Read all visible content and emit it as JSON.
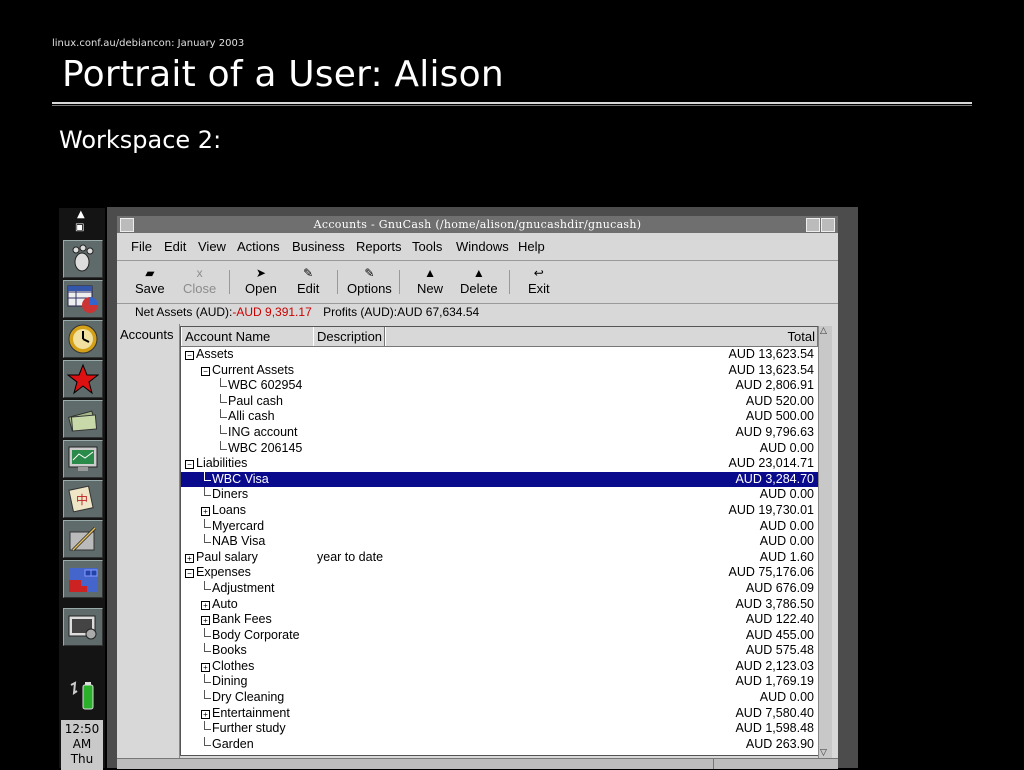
{
  "slide": {
    "source": "linux.conf.au/debiancon: January 2003",
    "title": "Portrait of a User: Alison",
    "subtitle": "Workspace 2:"
  },
  "dock": {
    "items": [
      "gnome-foot-icon",
      "spreadsheet-chart-icon",
      "mail-clock-icon",
      "star-icon",
      "money-icon",
      "monitor-icon",
      "game-tile-icon",
      "drawing-icon",
      "tetris-icon",
      "terminal-icon"
    ],
    "clock": {
      "time": "12:50",
      "ampm": "AM",
      "day": "Thu"
    }
  },
  "window": {
    "title": "Accounts - GnuCash (/home/alison/gnucashdir/gnucash)",
    "menus": [
      "File",
      "Edit",
      "View",
      "Actions",
      "Business",
      "Reports",
      "Tools",
      "Windows",
      "Help"
    ],
    "toolbar": [
      {
        "label": "Save",
        "icon": "save-icon",
        "enabled": true
      },
      {
        "label": "Close",
        "icon": "close-icon",
        "enabled": false
      },
      {
        "label": "Open",
        "icon": "open-icon",
        "enabled": true
      },
      {
        "label": "Edit",
        "icon": "edit-icon",
        "enabled": true
      },
      {
        "label": "Options",
        "icon": "options-icon",
        "enabled": true
      },
      {
        "label": "New",
        "icon": "new-icon",
        "enabled": true
      },
      {
        "label": "Delete",
        "icon": "delete-icon",
        "enabled": true
      },
      {
        "label": "Exit",
        "icon": "exit-icon",
        "enabled": true
      }
    ],
    "summary": {
      "net_assets_label": "Net Assets (AUD):",
      "net_assets_value": "-AUD 9,391.17",
      "profits_label": "Profits (AUD):",
      "profits_value": "AUD 67,634.54"
    },
    "accounts_tab": "Accounts",
    "columns": {
      "name": "Account Name",
      "description": "Description",
      "total": "Total"
    },
    "rows": [
      {
        "name": "Assets",
        "level": 0,
        "expander": "minus",
        "desc": "",
        "total": "AUD 13,623.54"
      },
      {
        "name": "Current Assets",
        "level": 1,
        "expander": "minus",
        "desc": "",
        "total": "AUD 13,623.54"
      },
      {
        "name": "WBC 602954",
        "level": 2,
        "expander": "",
        "desc": "",
        "total": "AUD 2,806.91"
      },
      {
        "name": "Paul cash",
        "level": 2,
        "expander": "",
        "desc": "",
        "total": "AUD 520.00"
      },
      {
        "name": "Alli cash",
        "level": 2,
        "expander": "",
        "desc": "",
        "total": "AUD 500.00"
      },
      {
        "name": "ING account",
        "level": 2,
        "expander": "",
        "desc": "",
        "total": "AUD 9,796.63"
      },
      {
        "name": "WBC 206145",
        "level": 2,
        "expander": "",
        "desc": "",
        "total": "AUD 0.00"
      },
      {
        "name": "Liabilities",
        "level": 0,
        "expander": "minus",
        "desc": "",
        "total": "AUD 23,014.71"
      },
      {
        "name": "WBC Visa",
        "level": 1,
        "expander": "",
        "desc": "",
        "total": "AUD 3,284.70",
        "selected": true
      },
      {
        "name": "Diners",
        "level": 1,
        "expander": "",
        "desc": "",
        "total": "AUD 0.00"
      },
      {
        "name": "Loans",
        "level": 1,
        "expander": "plus",
        "desc": "",
        "total": "AUD 19,730.01"
      },
      {
        "name": "Myercard",
        "level": 1,
        "expander": "",
        "desc": "",
        "total": "AUD 0.00"
      },
      {
        "name": "NAB Visa",
        "level": 1,
        "expander": "",
        "desc": "",
        "total": "AUD 0.00"
      },
      {
        "name": "Paul salary",
        "level": 0,
        "expander": "plus",
        "desc": "year to date",
        "total": "AUD 1.60"
      },
      {
        "name": "Expenses",
        "level": 0,
        "expander": "minus",
        "desc": "",
        "total": "AUD 75,176.06"
      },
      {
        "name": "Adjustment",
        "level": 1,
        "expander": "",
        "desc": "",
        "total": "AUD 676.09"
      },
      {
        "name": "Auto",
        "level": 1,
        "expander": "plus",
        "desc": "",
        "total": "AUD 3,786.50"
      },
      {
        "name": "Bank Fees",
        "level": 1,
        "expander": "plus",
        "desc": "",
        "total": "AUD 122.40"
      },
      {
        "name": "Body Corporate",
        "level": 1,
        "expander": "",
        "desc": "",
        "total": "AUD 455.00"
      },
      {
        "name": "Books",
        "level": 1,
        "expander": "",
        "desc": "",
        "total": "AUD 575.48"
      },
      {
        "name": "Clothes",
        "level": 1,
        "expander": "plus",
        "desc": "",
        "total": "AUD 2,123.03"
      },
      {
        "name": "Dining",
        "level": 1,
        "expander": "",
        "desc": "",
        "total": "AUD 1,769.19"
      },
      {
        "name": "Dry Cleaning",
        "level": 1,
        "expander": "",
        "desc": "",
        "total": "AUD 0.00"
      },
      {
        "name": "Entertainment",
        "level": 1,
        "expander": "plus",
        "desc": "",
        "total": "AUD 7,580.40"
      },
      {
        "name": "Further study",
        "level": 1,
        "expander": "",
        "desc": "",
        "total": "AUD 1,598.48"
      },
      {
        "name": "Garden",
        "level": 1,
        "expander": "",
        "desc": "",
        "total": "AUD 263.90"
      }
    ]
  },
  "colors": {
    "selection": "#0a0a8c",
    "negative": "#cc0000",
    "window_bg": "#d8d8d8"
  }
}
